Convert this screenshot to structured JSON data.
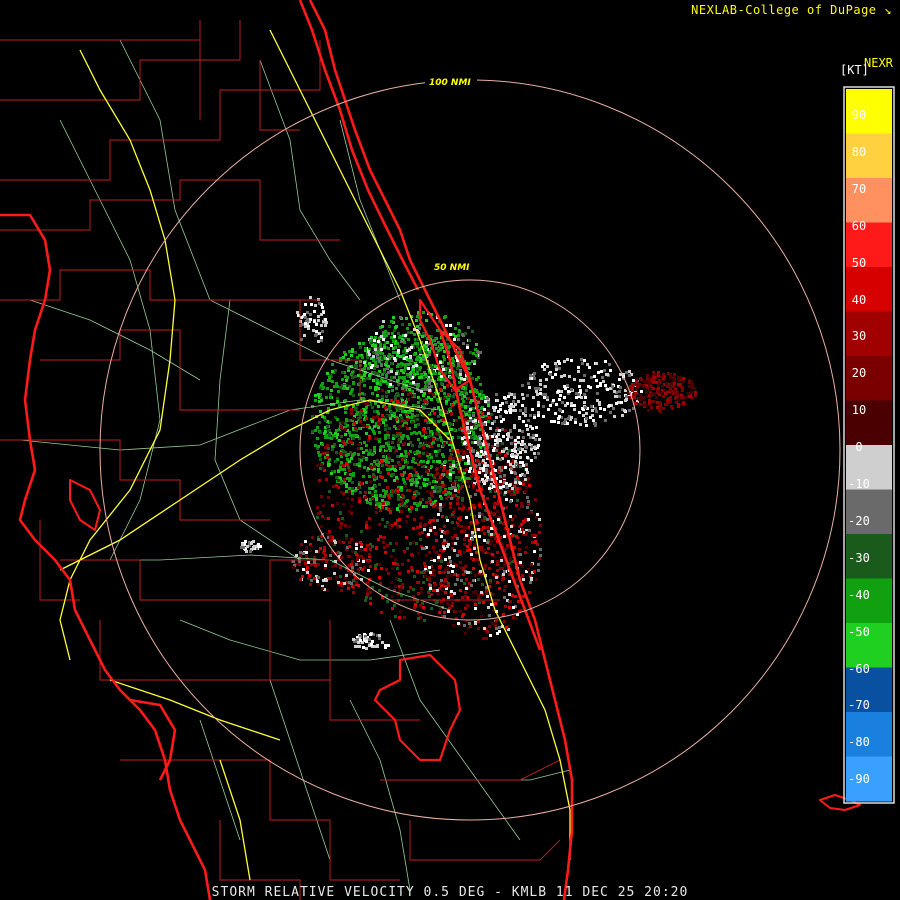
{
  "header": {
    "credit": "NEXLAB-College of DuPage",
    "credit_icon": "corner-arrow-icon",
    "product": "NEXR",
    "units": "[KT]"
  },
  "map": {
    "range_rings": [
      {
        "label": "50 NMI"
      },
      {
        "label": "100 NMI"
      }
    ],
    "colors": {
      "background": "#000000",
      "coastline": "#ff1a1a",
      "county_lines": "#c81e1e",
      "roads": "#a7e3a7",
      "highways": "#ffff33",
      "range_ring": "#e8b0a0"
    }
  },
  "legend": {
    "ticks": [
      "90",
      "80",
      "70",
      "60",
      "50",
      "40",
      "30",
      "20",
      "10",
      "0",
      "-10",
      "-20",
      "-30",
      "-40",
      "-50",
      "-60",
      "-70",
      "-80",
      "-90"
    ],
    "colors": [
      "#ffff00",
      "#ffd040",
      "#ff9060",
      "#ff1a1a",
      "#d60000",
      "#a00000",
      "#7a0000",
      "#4a0000",
      "#cfcfcf",
      "#6a6a6a",
      "#1a5a1a",
      "#10a010",
      "#20d020",
      "#0a50a0",
      "#1a80e0",
      "#3aa0ff"
    ]
  },
  "footer": {
    "caption": "STORM RELATIVE VELOCITY 0.5 DEG - KMLB 11 DEC 25 20:20"
  }
}
